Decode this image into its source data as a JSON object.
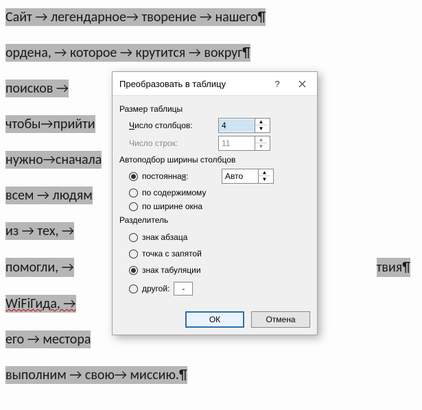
{
  "doc_lines": [
    "Сайт → легендарное→ творение  →   нашего¶",
    "ордена,  →   которое  →   крутится  →  вокруг¶",
    "поисков  →",
    "чтобы→прийти",
    "нужно→сначала",
    "всем → людям",
    "из  →  тех, →",
    "помогли,  →",
    "WiFiГида,  →",
    "его → местора",
    "выполним → свою→ миссию.¶"
  ],
  "extra_right": "твия¶",
  "dialog": {
    "title": "Преобразовать в таблицу",
    "help": "?",
    "sections": {
      "size": "Размер таблицы",
      "autofit": "Автоподбор ширины столбцов",
      "separator": "Разделитель"
    },
    "cols_label_pre": "Ч",
    "cols_label": "исло столбцов:",
    "cols_value": "4",
    "rows_label": "Число строк:",
    "rows_value": "11",
    "fixed_label_pre": "постоянна",
    "fixed_label_ul": "я",
    "fixed_label_post": ":",
    "fixed_value": "Авто",
    "fit_content": "по содержимому",
    "fit_window": "по ширине окна",
    "sep_para_ul": "з",
    "sep_para": "нак абзаца",
    "sep_tab_ul": "з",
    "sep_tab": "нак табуляции",
    "sep_semi_ul": "т",
    "sep_semi": "очка с запятой",
    "sep_other_ul": "д",
    "sep_other": "ругой:",
    "sep_other_value": "-",
    "ok": "ОК",
    "cancel": "Отмена"
  }
}
